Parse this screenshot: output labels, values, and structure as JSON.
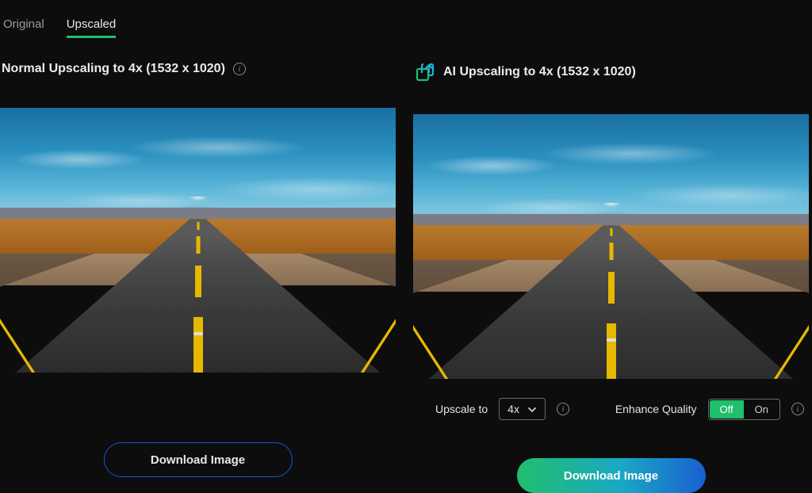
{
  "tabs": {
    "original": "Original",
    "upscaled": "Upscaled",
    "active": "upscaled"
  },
  "left": {
    "heading": "Normal Upscaling to 4x (1532 x 1020)",
    "download": "Download Image"
  },
  "right": {
    "heading": "AI Upscaling to 4x (1532 x 1020)",
    "download": "Download Image",
    "controls": {
      "upscale_label": "Upscale to",
      "upscale_value": "4x",
      "enhance_label": "Enhance Quality",
      "enhance_off": "Off",
      "enhance_on": "On",
      "enhance_state": "off"
    }
  }
}
